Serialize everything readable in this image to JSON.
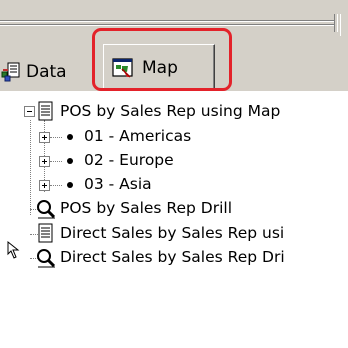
{
  "tabs": [
    {
      "label": "Data",
      "icon": "data-report-icon",
      "selected": false
    },
    {
      "label": "Map",
      "icon": "map-icon",
      "selected": true
    }
  ],
  "highlight_color": "#e3222a",
  "tree": {
    "items": [
      {
        "label": "POS by Sales Rep using Map",
        "icon": "document-icon",
        "expanded": true
      },
      {
        "label": "01 - Americas",
        "icon": "bullet-icon",
        "expandable": true
      },
      {
        "label": "02 - Europe",
        "icon": "bullet-icon",
        "expandable": true
      },
      {
        "label": "03 - Asia",
        "icon": "bullet-icon",
        "expandable": true
      },
      {
        "label": "POS by Sales Rep Drill",
        "icon": "magnifier-icon"
      },
      {
        "label": "Direct Sales by Sales Rep usi",
        "icon": "document-icon"
      },
      {
        "label": "Direct Sales by Sales Rep Dri",
        "icon": "magnifier-icon"
      }
    ]
  }
}
